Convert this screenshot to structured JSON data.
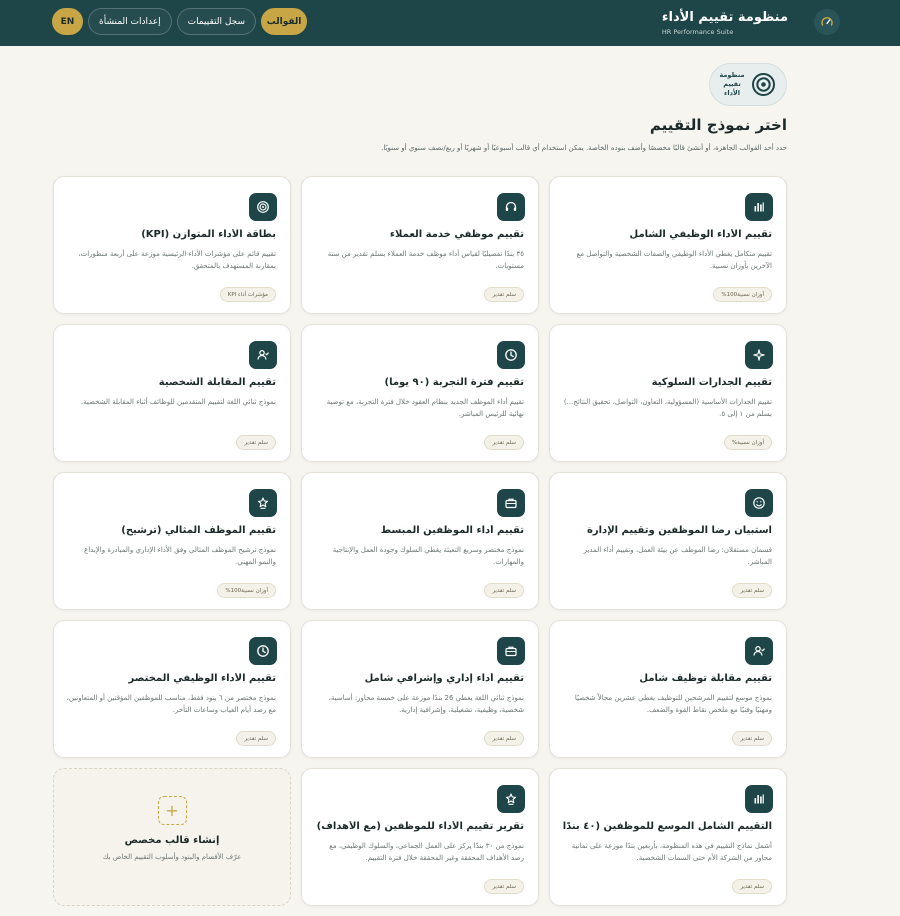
{
  "app": {
    "title": "منظومة تقييم الأداء",
    "subtitle": "HR Performance Suite"
  },
  "nav": {
    "templates": "القوالب",
    "history": "سجل التقييمات",
    "settings": "إعدادات المنشأة",
    "lang": "EN"
  },
  "org_badge": "منظومة تقييم الأداء",
  "page": {
    "title": "اختر نموذج التقييم",
    "desc": "حدد أحد القوالب الجاهزة، أو أنشئ قالبًا مخصصًا وأضف بنوده الخاصة. يمكن استخدام أي قالب أسبوعيًا أو شهريًا أو ربع/نصف سنوي أو سنويًا."
  },
  "cards": [
    {
      "icon": "bar-chart-icon",
      "title": "تقييم الأداء الوظيفي الشامل",
      "desc": "تقييم متكامل يغطي الأداء الوظيفي والصفات الشخصية والتواصل مع الآخرين بأوزان نسبية.",
      "tag": "أوزان نسبية100%"
    },
    {
      "icon": "headset-icon",
      "title": "تقييم موظفي خدمة العملاء",
      "desc": "٣٥ بندًا تفصيليًا لقياس أداء موظف خدمة العملاء بسلم تقدير من ستة مستويات.",
      "tag": "سلم تقدير"
    },
    {
      "icon": "target-icon",
      "title": "بطاقة الأداء المتوازن (KPI)",
      "desc": "تقييم قائم على مؤشرات الأداء الرئيسية موزعة على أربعة منظورات، بمقارنة المستهدف بالمتحقق.",
      "tag": "مؤشرات أداء KPI"
    },
    {
      "icon": "sparkle-icon",
      "title": "تقييم الجدارات السلوكية",
      "desc": "تقييم الجدارات الأساسية (المسؤولية، التعاون، التواصل، تحقيق النتائج...) بسلم من ١ إلى ٥.",
      "tag": "أوزان نسبية%"
    },
    {
      "icon": "clock-icon",
      "title": "تقييم فترة التجربة (٩٠ يوما)",
      "desc": "تقييم أداء الموظف الجديد بنظام العقود خلال فترة التجربة، مع توصية نهائية للرئيس المباشر.",
      "tag": "سلم تقدير"
    },
    {
      "icon": "user-check-icon",
      "title": "تقييم المقابلة الشخصية",
      "desc": "نموذج ثنائي اللغة لتقييم المتقدمين للوظائف أثناء المقابلة الشخصية.",
      "tag": "سلم تقدير"
    },
    {
      "icon": "smile-icon",
      "title": "استبيان رضا الموظفين وتقييم الإدارة",
      "desc": "قسمان مستقلان: رضا الموظف عن بيئة العمل، وتقييم أداء المدير المباشر.",
      "tag": "سلم تقدير"
    },
    {
      "icon": "briefcase-icon",
      "title": "تقييم أداء الموظفين المبسط",
      "desc": "نموذج مختصر وسريع التعبئة يغطي السلوك وجودة العمل والإنتاجية والمهارات.",
      "tag": "سلم تقدير"
    },
    {
      "icon": "star-badge-icon",
      "title": "تقييم الموظف المثالي (ترشيح)",
      "desc": "نموذج ترشيح الموظف المثالي وفق الأداء الإداري والمبادرة والإبداع والنمو المهني.",
      "tag": "أوزان نسبية100%"
    },
    {
      "icon": "user-check-icon",
      "title": "تقييم مقابلة توظيف شامل",
      "desc": "نموذج موسع لتقييم المرشحين للتوظيف يغطي عشرين مجالاً شخصيًا ومهنيًا وفنيًا مع ملخص نقاط القوة والضعف.",
      "tag": "سلم تقدير"
    },
    {
      "icon": "briefcase-icon",
      "title": "تقييم أداء إداري وإشرافي شامل",
      "desc": "نموذج ثنائي اللغة يغطي 26 بندًا موزعة على خمسة محاور: أساسية، شخصية، وظيفية، تشغيلية، وإشرافية إدارية.",
      "tag": "سلم تقدير"
    },
    {
      "icon": "clock-icon",
      "title": "تقييم الأداء الوظيفي المختصر",
      "desc": "نموذج مختصر من ٦ بنود فقط، مناسب للموظفين المؤقتين أو المتعاونين، مع رصد أيام الغياب وساعات التأخر.",
      "tag": "سلم تقدير"
    },
    {
      "icon": "bar-chart-icon",
      "title": "التقييم الشامل الموسع للموظفين (٤٠ بندًا)",
      "desc": "أشمل نماذج التقييم في هذه المنظومة، بأربعين بندًا موزعة على ثمانية محاور من الشركة الأم حتى السمات الشخصية.",
      "tag": "سلم تقدير"
    },
    {
      "icon": "star-badge-icon",
      "title": "تقرير تقييم الأداء للموظفين (مع الأهداف)",
      "desc": "نموذج من ٣٠ بندًا يركز على العمل الجماعي، والسلوك الوظيفي، مع رصد الأهداف المحققة وغير المحققة خلال فترة التقييم.",
      "tag": "سلم تقدير"
    }
  ],
  "create": {
    "icon": "plus-icon",
    "title": "إنشاء قالب مخصص",
    "desc": "عرّف الأقسام والبنود وأسلوب التقييم الخاص بك"
  },
  "colors": {
    "primary": "#1e4548",
    "accent": "#c8a646",
    "background": "#f7f5f0"
  }
}
